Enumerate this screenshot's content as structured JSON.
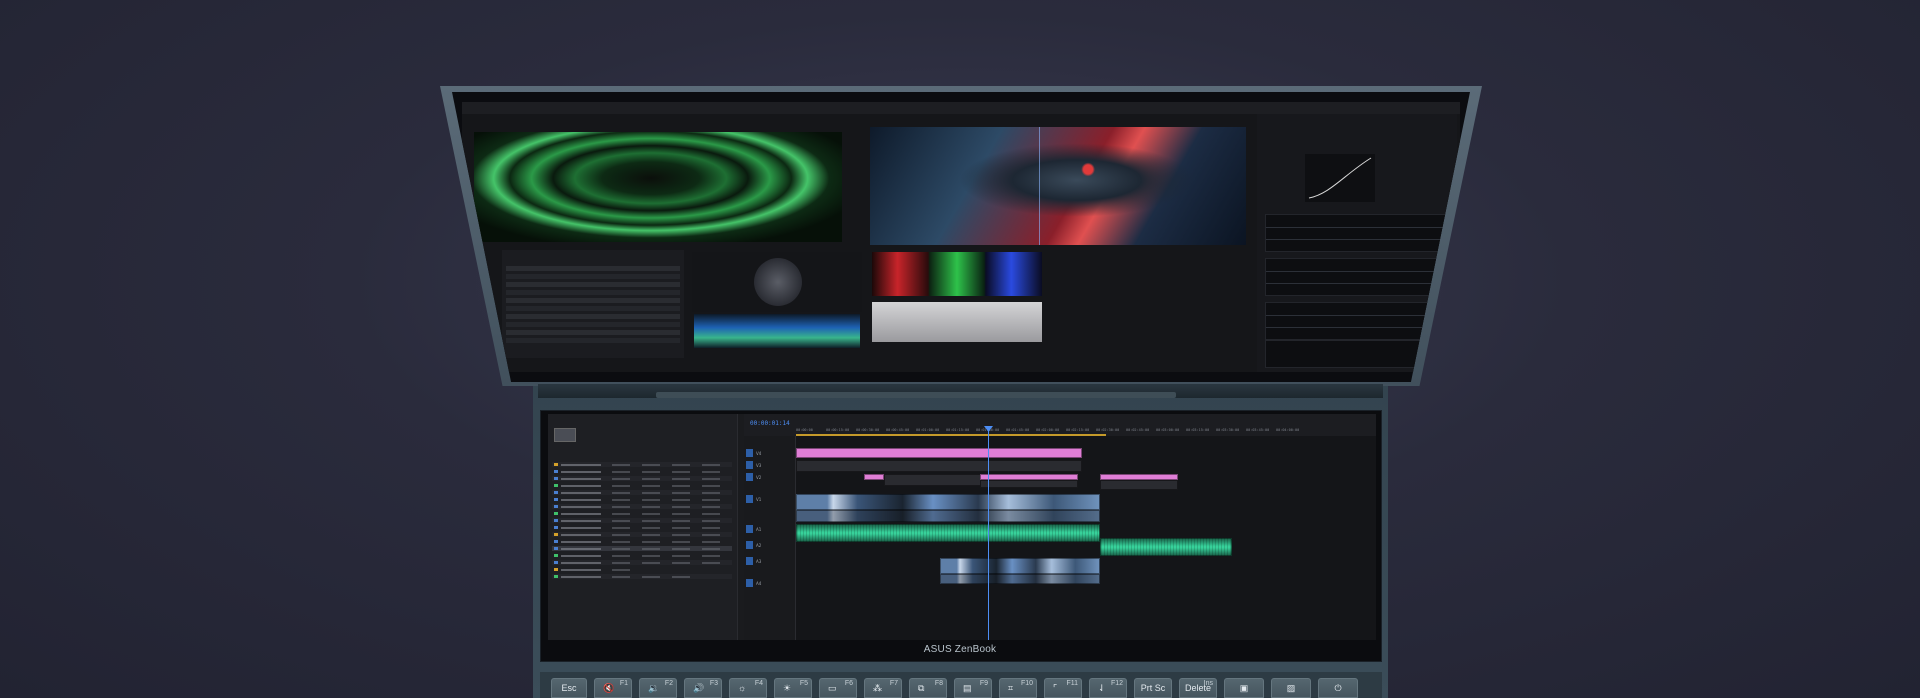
{
  "brand": {
    "label": "ASUS ZenBook"
  },
  "keyboard": {
    "esc": "Esc",
    "keys": [
      {
        "fn": "F1",
        "icon": "🔇"
      },
      {
        "fn": "F2",
        "icon": "🔉"
      },
      {
        "fn": "F3",
        "icon": "🔊"
      },
      {
        "fn": "F4",
        "icon": "☼"
      },
      {
        "fn": "F5",
        "icon": "☀"
      },
      {
        "fn": "F6",
        "icon": "▭"
      },
      {
        "fn": "F7",
        "icon": "⁂"
      },
      {
        "fn": "F8",
        "icon": "⧉"
      },
      {
        "fn": "F9",
        "icon": "▤"
      },
      {
        "fn": "F10",
        "icon": "⌗"
      },
      {
        "fn": "F11",
        "icon": "⌜"
      },
      {
        "fn": "F12",
        "icon": "⇃"
      }
    ],
    "prtsc": "Prt Sc",
    "delete": "Delete",
    "delete_fn": "Ins",
    "extra_icons": [
      "▣",
      "▨",
      "⏻"
    ]
  },
  "timeline": {
    "timecode": "00:00:01:14",
    "ruler": [
      "00:00:00",
      "00:00:15:00",
      "00:00:30:00",
      "00:00:45:00",
      "00:01:00:00",
      "00:01:15:00",
      "00:01:30:00",
      "00:01:45:00",
      "00:02:00:00",
      "00:02:15:00",
      "00:02:30:00",
      "00:02:45:00",
      "00:03:00:00",
      "00:03:15:00",
      "00:03:30:00",
      "00:03:45:00",
      "00:04:00:00"
    ],
    "tracks": [
      "V4",
      "V3",
      "V2",
      "V1",
      "A1",
      "A2",
      "A3",
      "A4"
    ]
  },
  "colors": {
    "accent": "#4d8ef5",
    "clip_pink": "#e07ed6",
    "clip_audio": "#37d19a",
    "bg": "#2a2b3c"
  }
}
